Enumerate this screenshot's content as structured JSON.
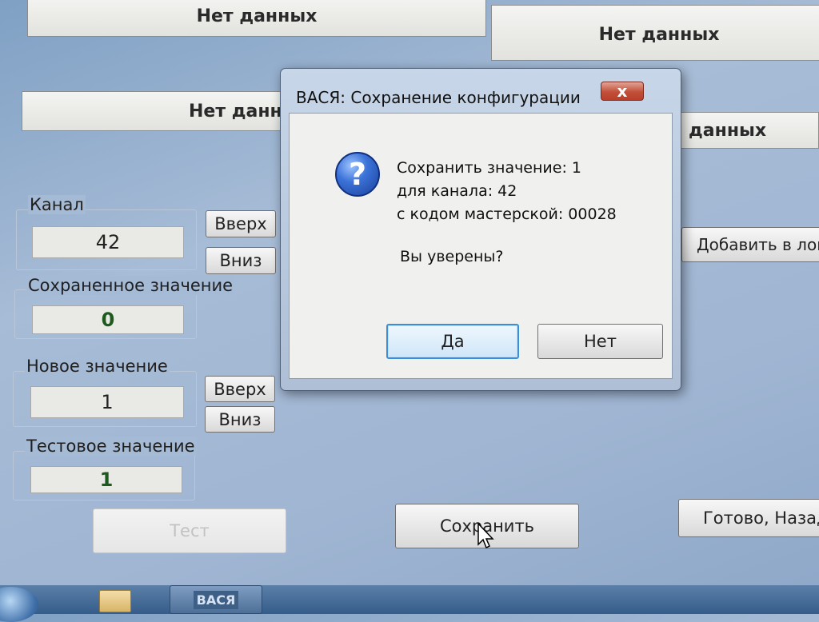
{
  "status_panels": {
    "top_left": "Нет данных",
    "top_right": "Нет данных",
    "middle_left": "Нет данных",
    "middle_right": "данных"
  },
  "channel": {
    "label": "Канал",
    "value": "42",
    "up_label": "Вверх",
    "down_label": "Вниз"
  },
  "saved_value": {
    "label": "Сохраненное значение",
    "value": "0"
  },
  "new_value": {
    "label": "Новое значение",
    "value": "1",
    "up_label": "Вверх",
    "down_label": "Вниз"
  },
  "test_value": {
    "label": "Тестовое значение",
    "value": "1"
  },
  "buttons": {
    "add_to_log": "Добавить в лог",
    "test": "Тест",
    "save": "Сохранить",
    "done_back": "Готово, Назад"
  },
  "dialog": {
    "title": "ВАСЯ: Сохранение конфигурации",
    "close_glyph": "x",
    "icon": "question-icon",
    "lines": [
      "Сохранить значение: 1",
      "для канала: 42",
      "с кодом мастерской: 00028"
    ],
    "question": "Вы уверены?",
    "yes_label": "Да",
    "no_label": "Нет"
  },
  "taskbar": {
    "app_label": "ВАСЯ"
  }
}
